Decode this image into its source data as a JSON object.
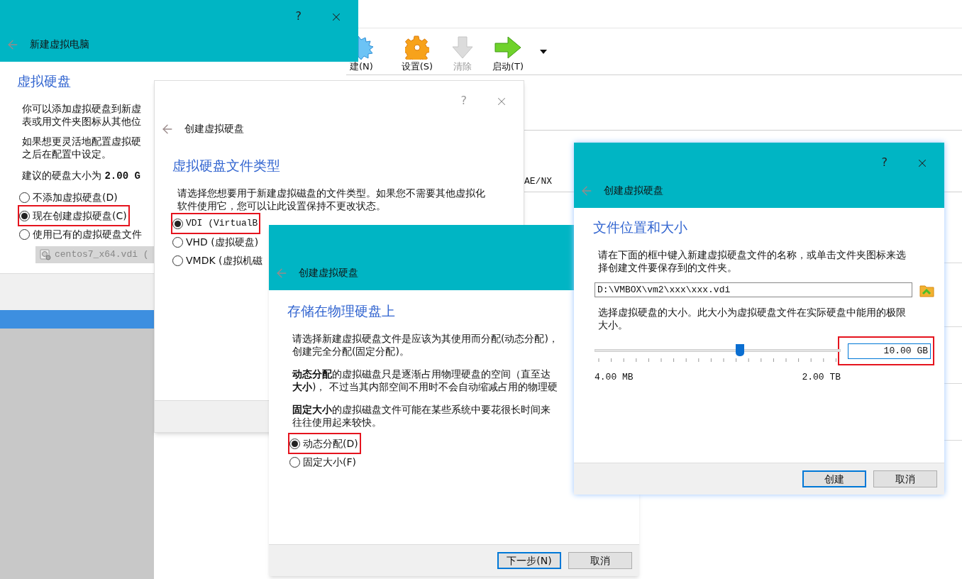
{
  "main_window": {
    "toolbar": [
      {
        "kind": "new",
        "label": "建(N)",
        "disabled": false
      },
      {
        "kind": "settings",
        "label": "设置(S)",
        "disabled": false
      },
      {
        "kind": "discard",
        "label": "清除",
        "disabled": true
      },
      {
        "kind": "start",
        "label": "启动(T)",
        "disabled": false
      }
    ],
    "detail_text": "AE/NX"
  },
  "new_vm_dialog": {
    "title": "新建虚拟电脑",
    "help": "?",
    "heading": "虚拟硬盘",
    "paragraphs": [
      [
        "你可以添加虚拟硬盘到新虚",
        "表或用文件夹图标从其他位"
      ],
      [
        "如果想更灵活地配置虚拟硬",
        "之后在配置中设定。"
      ],
      [
        "建议的硬盘大小为 **2.00 G**"
      ]
    ],
    "options": [
      {
        "label": "不添加虚拟硬盘(D)",
        "selected": false,
        "highlighted": false
      },
      {
        "label": "现在创建虚拟硬盘(C)",
        "selected": true,
        "highlighted": true
      },
      {
        "label": "使用已有的虚拟硬盘文件",
        "selected": false,
        "highlighted": false
      }
    ],
    "disk_combo": {
      "value": "centos7_x64.vdi (",
      "disabled": true
    }
  },
  "file_type_dialog": {
    "title": "创建虚拟硬盘",
    "help": "?",
    "heading": "虚拟硬盘文件类型",
    "paragraphs": [
      [
        "请选择您想要用于新建虚拟磁盘的文件类型。如果您不需要其他虚拟化",
        "软件使用它，您可以让此设置保持不更改状态。"
      ]
    ],
    "options": [
      {
        "label": "VDI (VirtualB",
        "selected": true,
        "highlighted": true
      },
      {
        "label": "VHD (虚拟硬盘)",
        "selected": false,
        "highlighted": false
      },
      {
        "label": "VMDK (虚拟机磁",
        "selected": false,
        "highlighted": false
      }
    ]
  },
  "storage_dialog": {
    "title": "创建虚拟硬盘",
    "heading": "存储在物理硬盘上",
    "paragraphs": [
      [
        "请选择新建虚拟硬盘文件是应该为其使用而分配(动态分配)，",
        "创建完全分配(固定分配)。"
      ],
      [
        "**动态分配**的虚拟磁盘只是逐渐占用物理硬盘的空间（直至达",
        "**大小**)， 不过当其内部空间不用时不会自动缩减占用的物理硬"
      ],
      [
        "**固定大小**的虚拟磁盘文件可能在某些系统中要花很长时间来",
        "往往使用起来较快。"
      ]
    ],
    "options": [
      {
        "label": "动态分配(D)",
        "selected": true,
        "highlighted": true
      },
      {
        "label": "固定大小(F)",
        "selected": false,
        "highlighted": false
      }
    ],
    "buttons": [
      {
        "label": "下一步(N)",
        "default": true
      },
      {
        "label": "取消",
        "default": false
      }
    ]
  },
  "location_dialog": {
    "title": "创建虚拟硬盘",
    "help": "?",
    "heading": "文件位置和大小",
    "paragraphs": [
      [
        "请在下面的框中键入新建虚拟硬盘文件的名称，或单击文件夹图标来选",
        "择创建文件要保存到的文件夹。"
      ]
    ],
    "path": "D:\\VMBOX\\vm2\\xxx\\xxx.vdi",
    "size_paragraph": [
      "选择虚拟硬盘的大小。此大小为虚拟硬盘文件在实际硬盘中能用的极限",
      "大小。"
    ],
    "size_slider": {
      "level": 0.59,
      "min_label": "4.00 MB",
      "max_label": "2.00 TB"
    },
    "size_field": {
      "value": "10.00 GB",
      "highlighted": true
    },
    "buttons": [
      {
        "label": "创建",
        "default": true
      },
      {
        "label": "取消",
        "default": false
      }
    ]
  }
}
